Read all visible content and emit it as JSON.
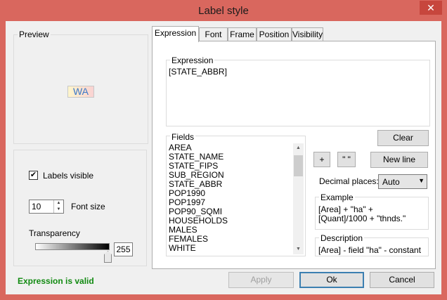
{
  "window": {
    "title": "Label style",
    "close_symbol": "✕"
  },
  "preview": {
    "legend": "Preview",
    "sample_text": "WA"
  },
  "options": {
    "labels_visible_label": "Labels visible",
    "labels_visible_checked": true,
    "font_size_label": "Font size",
    "font_size_value": "10",
    "transparency_label": "Transparency",
    "transparency_value": "255"
  },
  "status": {
    "text": "Expression is valid",
    "color": "#118a11"
  },
  "tabs": [
    "Expression",
    "Font",
    "Frame",
    "Position",
    "Visibility"
  ],
  "active_tab": "Expression",
  "expression": {
    "legend": "Expression",
    "value": "[STATE_ABBR]"
  },
  "fields": {
    "legend": "Fields",
    "items": [
      "AREA",
      "STATE_NAME",
      "STATE_FIPS",
      "SUB_REGION",
      "STATE_ABBR",
      "POP1990",
      "POP1997",
      "POP90_SQMI",
      "HOUSEHOLDS",
      "MALES",
      "FEMALES",
      "WHITE"
    ]
  },
  "buttons": {
    "clear": "Clear",
    "plus": "+",
    "quotes": "\" \"",
    "new_line": "New line",
    "apply": "Apply",
    "ok": "Ok",
    "cancel": "Cancel"
  },
  "decimal": {
    "label": "Decimal places:",
    "value": "Auto"
  },
  "example": {
    "legend": "Example",
    "line1": "[Area] + \"ha\" +",
    "line2": "[Quant]/1000 + \"thnds.\""
  },
  "description": {
    "legend": "Description",
    "text": "[Area]  - field \"ha\" - constant"
  }
}
